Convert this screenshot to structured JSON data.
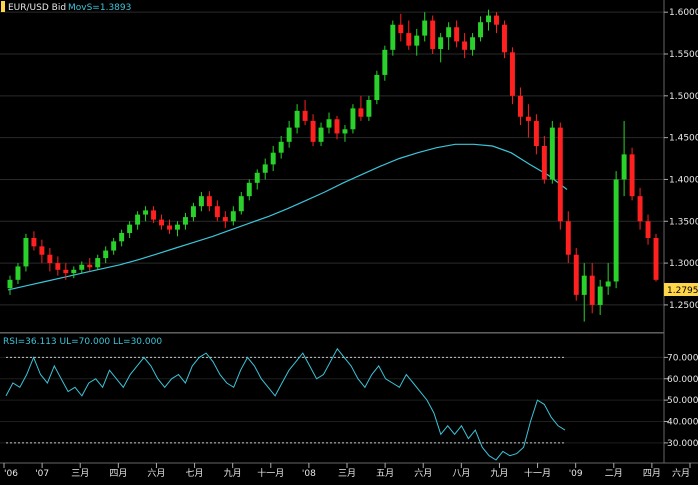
{
  "chart_data": [
    {
      "type": "candlestick",
      "title": "EUR/USD Bid",
      "overlay_label": "MovS=1.3893",
      "ylim": [
        1.22,
        1.605
      ],
      "y_ticks": [
        "1.6000",
        "1.5500",
        "1.5000",
        "1.4500",
        "1.4000",
        "1.3500",
        "1.3000",
        "1.2500"
      ],
      "last_value_label": "1.2795",
      "last_value": 1.2795,
      "x_ticks": [
        "'06",
        "'07",
        "三月",
        "四月",
        "六月",
        "七月",
        "九月",
        "十一月",
        "'08",
        "三月",
        "五月",
        "六月",
        "八月",
        "九月",
        "十一月",
        "'09",
        "二月",
        "四月",
        "六月"
      ],
      "grid": true,
      "colors": {
        "up": "#2bd12b",
        "down": "#ff2020",
        "moving_average": "#3cc4d8",
        "background": "#000000",
        "grid": "#2a2a2a"
      },
      "candles": [
        [
          1.27,
          1.285,
          1.262,
          1.28
        ],
        [
          1.28,
          1.3,
          1.275,
          1.296
        ],
        [
          1.296,
          1.335,
          1.29,
          1.33
        ],
        [
          1.33,
          1.338,
          1.315,
          1.32
        ],
        [
          1.32,
          1.328,
          1.3,
          1.31
        ],
        [
          1.31,
          1.318,
          1.29,
          1.3
        ],
        [
          1.3,
          1.308,
          1.285,
          1.292
        ],
        [
          1.292,
          1.3,
          1.28,
          1.288
        ],
        [
          1.288,
          1.296,
          1.282,
          1.292
        ],
        [
          1.292,
          1.302,
          1.288,
          1.298
        ],
        [
          1.298,
          1.306,
          1.29,
          1.295
        ],
        [
          1.295,
          1.31,
          1.292,
          1.306
        ],
        [
          1.306,
          1.32,
          1.3,
          1.315
        ],
        [
          1.315,
          1.33,
          1.31,
          1.326
        ],
        [
          1.326,
          1.34,
          1.32,
          1.336
        ],
        [
          1.336,
          1.35,
          1.33,
          1.346
        ],
        [
          1.346,
          1.362,
          1.34,
          1.358
        ],
        [
          1.358,
          1.368,
          1.35,
          1.363
        ],
        [
          1.363,
          1.368,
          1.348,
          1.352
        ],
        [
          1.352,
          1.358,
          1.34,
          1.345
        ],
        [
          1.345,
          1.352,
          1.335,
          1.34
        ],
        [
          1.34,
          1.35,
          1.332,
          1.346
        ],
        [
          1.346,
          1.36,
          1.34,
          1.355
        ],
        [
          1.355,
          1.372,
          1.35,
          1.368
        ],
        [
          1.368,
          1.385,
          1.362,
          1.38
        ],
        [
          1.38,
          1.386,
          1.362,
          1.368
        ],
        [
          1.368,
          1.375,
          1.35,
          1.355
        ],
        [
          1.355,
          1.362,
          1.342,
          1.35
        ],
        [
          1.35,
          1.368,
          1.345,
          1.362
        ],
        [
          1.362,
          1.385,
          1.358,
          1.38
        ],
        [
          1.38,
          1.4,
          1.375,
          1.396
        ],
        [
          1.396,
          1.412,
          1.388,
          1.408
        ],
        [
          1.408,
          1.425,
          1.4,
          1.418
        ],
        [
          1.418,
          1.44,
          1.41,
          1.432
        ],
        [
          1.432,
          1.452,
          1.425,
          1.445
        ],
        [
          1.445,
          1.47,
          1.438,
          1.462
        ],
        [
          1.462,
          1.49,
          1.455,
          1.482
        ],
        [
          1.482,
          1.495,
          1.465,
          1.47
        ],
        [
          1.47,
          1.478,
          1.44,
          1.445
        ],
        [
          1.445,
          1.468,
          1.44,
          1.462
        ],
        [
          1.462,
          1.48,
          1.455,
          1.472
        ],
        [
          1.472,
          1.476,
          1.448,
          1.455
        ],
        [
          1.455,
          1.465,
          1.445,
          1.46
        ],
        [
          1.46,
          1.49,
          1.455,
          1.485
        ],
        [
          1.485,
          1.5,
          1.47,
          1.475
        ],
        [
          1.475,
          1.5,
          1.47,
          1.495
        ],
        [
          1.495,
          1.53,
          1.49,
          1.525
        ],
        [
          1.525,
          1.56,
          1.518,
          1.555
        ],
        [
          1.555,
          1.59,
          1.548,
          1.585
        ],
        [
          1.585,
          1.598,
          1.565,
          1.575
        ],
        [
          1.575,
          1.59,
          1.555,
          1.56
        ],
        [
          1.56,
          1.58,
          1.548,
          1.572
        ],
        [
          1.572,
          1.6,
          1.565,
          1.59
        ],
        [
          1.59,
          1.596,
          1.55,
          1.556
        ],
        [
          1.556,
          1.575,
          1.54,
          1.57
        ],
        [
          1.57,
          1.588,
          1.555,
          1.582
        ],
        [
          1.582,
          1.59,
          1.558,
          1.565
        ],
        [
          1.565,
          1.575,
          1.545,
          1.555
        ],
        [
          1.555,
          1.575,
          1.548,
          1.57
        ],
        [
          1.57,
          1.595,
          1.565,
          1.588
        ],
        [
          1.588,
          1.603,
          1.578,
          1.596
        ],
        [
          1.596,
          1.6,
          1.575,
          1.585
        ],
        [
          1.585,
          1.59,
          1.545,
          1.552
        ],
        [
          1.552,
          1.558,
          1.49,
          1.5
        ],
        [
          1.5,
          1.51,
          1.465,
          1.475
        ],
        [
          1.475,
          1.49,
          1.45,
          1.47
        ],
        [
          1.47,
          1.478,
          1.43,
          1.44
        ],
        [
          1.44,
          1.452,
          1.395,
          1.4
        ],
        [
          1.4,
          1.47,
          1.395,
          1.462
        ],
        [
          1.462,
          1.468,
          1.34,
          1.35
        ],
        [
          1.35,
          1.362,
          1.3,
          1.31
        ],
        [
          1.31,
          1.318,
          1.255,
          1.262
        ],
        [
          1.262,
          1.3,
          1.23,
          1.285
        ],
        [
          1.285,
          1.3,
          1.24,
          1.25
        ],
        [
          1.25,
          1.28,
          1.238,
          1.272
        ],
        [
          1.272,
          1.3,
          1.262,
          1.278
        ],
        [
          1.278,
          1.41,
          1.27,
          1.4
        ],
        [
          1.4,
          1.47,
          1.38,
          1.43
        ],
        [
          1.43,
          1.438,
          1.375,
          1.38
        ],
        [
          1.38,
          1.39,
          1.34,
          1.35
        ],
        [
          1.35,
          1.358,
          1.322,
          1.33
        ],
        [
          1.33,
          1.335,
          1.278,
          1.28
        ]
      ],
      "moving_average": [
        1.268,
        1.273,
        1.278,
        1.283,
        1.288,
        1.293,
        1.298,
        1.304,
        1.311,
        1.318,
        1.325,
        1.332,
        1.34,
        1.348,
        1.356,
        1.365,
        1.375,
        1.385,
        1.396,
        1.406,
        1.416,
        1.425,
        1.432,
        1.438,
        1.442,
        1.442,
        1.44,
        1.432,
        1.418,
        1.405,
        1.388
      ]
    },
    {
      "type": "line",
      "title": "RSI=36.113 UL=70.000 LL=30.000",
      "ylim": [
        22,
        80
      ],
      "y_ticks": [
        "70.000",
        "60.000",
        "50.000",
        "40.000",
        "30.000"
      ],
      "upper_level": 70,
      "lower_level": 30,
      "grid": true,
      "colors": {
        "line": "#3cc4d8",
        "levels": "#c8c8c8"
      },
      "series": [
        {
          "values": [
            52,
            58,
            56,
            62,
            70,
            62,
            58,
            66,
            60,
            54,
            56,
            52,
            58,
            60,
            56,
            64,
            60,
            56,
            62,
            66,
            70,
            66,
            60,
            56,
            60,
            62,
            58,
            66,
            70,
            72,
            68,
            62,
            58,
            56,
            64,
            70,
            66,
            60,
            56,
            52,
            58,
            64,
            68,
            72,
            66,
            60,
            62,
            68,
            74,
            70,
            66,
            60,
            56,
            62,
            66,
            60,
            58,
            56,
            62,
            58,
            54,
            50,
            44,
            34,
            38,
            34,
            38,
            32,
            36,
            28,
            24,
            22,
            26,
            24,
            25,
            28,
            40,
            50,
            48,
            42,
            38,
            36
          ]
        }
      ]
    }
  ]
}
